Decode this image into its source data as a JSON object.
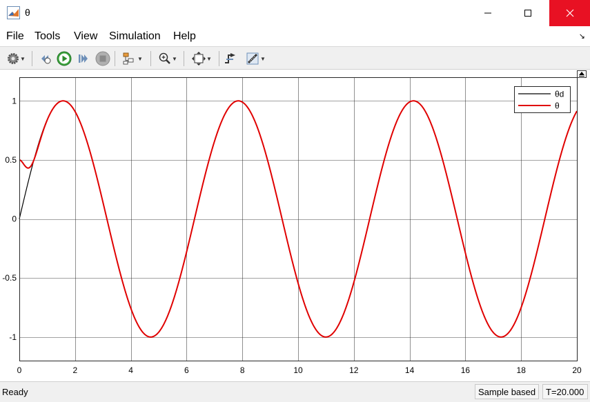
{
  "window": {
    "title": "θ"
  },
  "menu": {
    "file": "File",
    "tools": "Tools",
    "view": "View",
    "simulation": "Simulation",
    "help": "Help"
  },
  "toolbar": {
    "icons": [
      "settings-icon",
      "restore-icon",
      "run-icon",
      "step-forward-icon",
      "stop-icon",
      "highlight-icon",
      "zoom-icon",
      "fit-icon",
      "triggers-icon",
      "cursor-measure-icon"
    ]
  },
  "status": {
    "ready": "Ready",
    "sample": "Sample based",
    "time": "T=20.000"
  },
  "chart_data": {
    "type": "line",
    "x_range": [
      0,
      20
    ],
    "y_range": [
      -1.2,
      1.2
    ],
    "x_ticks": [
      "0",
      "2",
      "4",
      "6",
      "8",
      "10",
      "12",
      "14",
      "16",
      "18",
      "20"
    ],
    "y_ticks": [
      "1",
      "0.5",
      "0",
      "-0.5",
      "-1"
    ],
    "grid": true,
    "legend_position": "top-right",
    "series": [
      {
        "name": "θd",
        "color": "#000000",
        "function": "sin(t)",
        "x_start": 0,
        "x_end": 20
      },
      {
        "name": "θ",
        "color": "#e00000",
        "function": "tracks sin(t), starting at 0.5 and converging by t≈1.6",
        "start_value": 0.5,
        "x_start": 0,
        "x_end": 20
      }
    ]
  }
}
